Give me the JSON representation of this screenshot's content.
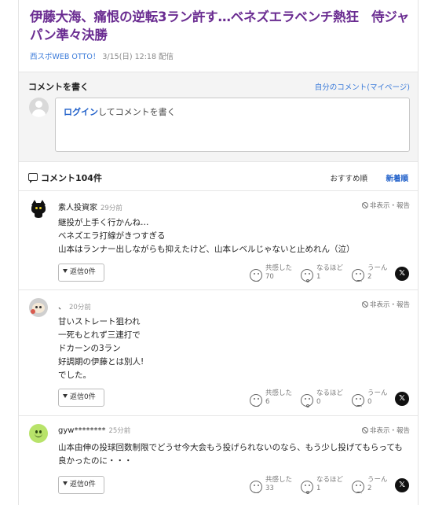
{
  "article": {
    "headline": "伊藤大海、痛恨の逆転3ラン許す…ベネズエラベンチ熱狂　侍ジャパン準々決勝",
    "source": "西スポWEB OTTO！",
    "date": "3/15(日) 12:18",
    "date_suffix": "配信"
  },
  "comment_form": {
    "title": "コメントを書く",
    "mypage_link": "自分のコメント(マイページ)",
    "login_label": "ログイン",
    "placeholder_suffix": "してコメントを書く"
  },
  "comment_list": {
    "count_label": "コメント104件",
    "sort_recommended": "おすすめ順",
    "sort_newest": "新着順"
  },
  "reaction_labels": {
    "empathy": "共感した",
    "convinced": "なるほど",
    "hmm": "うーん",
    "hide_report": "非表示・報告",
    "reply": "返信0件",
    "share_x": "𝕏"
  },
  "comments": [
    {
      "user": "素人投資家",
      "time": "29分前",
      "lines": [
        "継投が上手く行かんね…",
        "ベネズエラ打線がきつすぎる",
        "山本はランナー出しながらも抑えたけど、山本レベルじゃないと止めれん（泣）"
      ],
      "empathy": "70",
      "convinced": "1",
      "hmm": "2"
    },
    {
      "user": "、",
      "time": "20分前",
      "lines": [
        "甘いストレート狙われ",
        "一死もとれず三連打で",
        "ドカーンの3ラン",
        "好調期の伊藤とは別人!",
        "でした。"
      ],
      "empathy": "6",
      "convinced": "0",
      "hmm": "0"
    },
    {
      "user": "gyw********",
      "time": "25分前",
      "lines": [
        "山本由伸の投球回数制限でどうせ今大会もう投げられないのなら、もう少し投げてもらっても",
        "良かったのに・・・"
      ],
      "empathy": "33",
      "convinced": "1",
      "hmm": "2"
    }
  ]
}
